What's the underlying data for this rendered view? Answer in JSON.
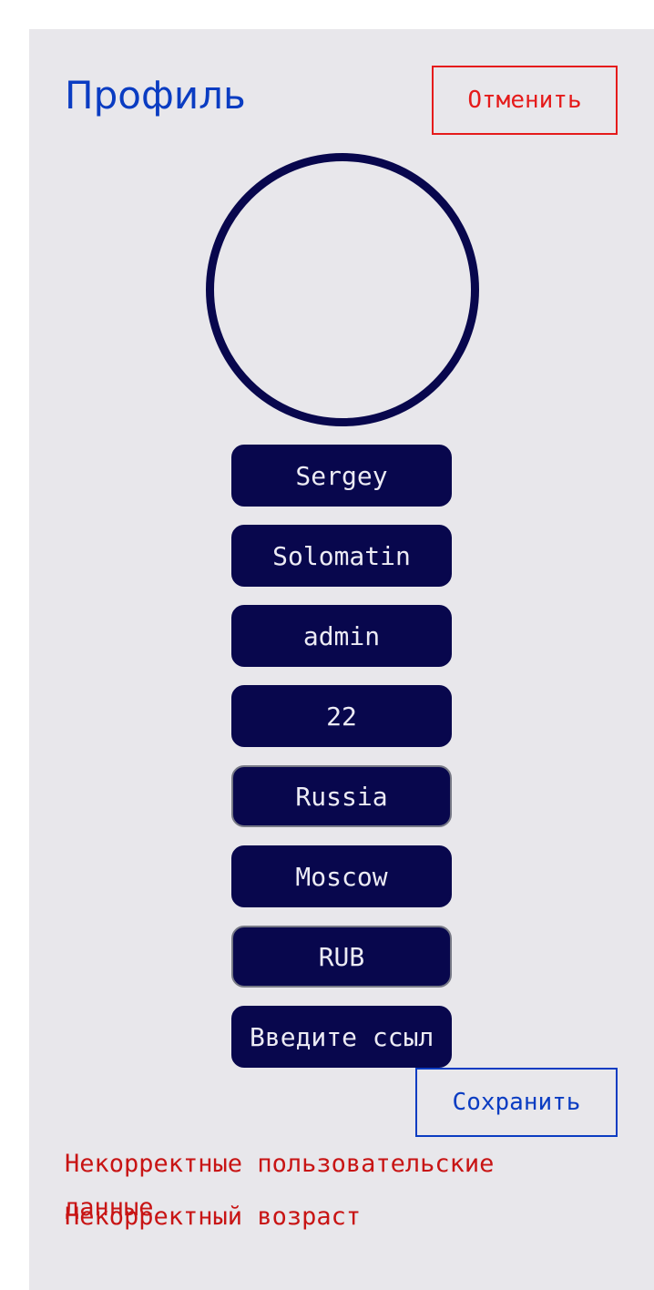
{
  "header": {
    "title": "Профиль",
    "cancel_label": "Отменить"
  },
  "avatar": {
    "icon": "avatar-circle-icon"
  },
  "form": {
    "first_name": "Sergey",
    "last_name": "Solomatin",
    "username": "admin",
    "age": "22",
    "country": "Russia",
    "city": "Moscow",
    "currency": "RUB",
    "link_placeholder": "Введите ссылку"
  },
  "footer": {
    "save_label": "Сохранить"
  },
  "errors": [
    "Некорректные пользовательские данные",
    "Некорректный возраст"
  ],
  "colors": {
    "background": "#e8e7eb",
    "accent_blue": "#0a3cc2",
    "danger_red": "#e51b1b",
    "field_navy": "#08074d"
  }
}
